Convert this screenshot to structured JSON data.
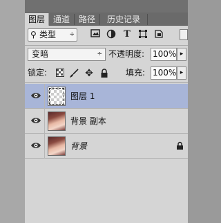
{
  "tabs": [
    {
      "label": "图层",
      "active": true
    },
    {
      "label": "通道",
      "active": false
    },
    {
      "label": "路径",
      "active": false
    },
    {
      "label": "历史记录",
      "active": false
    }
  ],
  "filter": {
    "search_symbol": "⚲",
    "kind_label": "类型",
    "caret": "÷",
    "icons": [
      "image-filter-icon",
      "adjustment-filter-icon",
      "type-filter-icon",
      "shape-filter-icon",
      "smart-object-filter-icon"
    ]
  },
  "blend": {
    "mode": "变暗",
    "caret": "÷",
    "opacity_label": "不透明度:",
    "opacity_value": "100%",
    "opacity_caret": "▸"
  },
  "locks": {
    "label": "锁定:",
    "icons": [
      "lock-transparent-icon",
      "lock-pixels-icon",
      "lock-position-icon",
      "lock-all-icon"
    ],
    "fill_label": "填充:",
    "fill_value": "100%",
    "fill_caret": "▸"
  },
  "layers": [
    {
      "name": "图层 1",
      "selected": true,
      "visible": true,
      "thumbnail": "transparent",
      "locked": false
    },
    {
      "name": "背景 副本",
      "selected": false,
      "visible": true,
      "thumbnail": "photo",
      "locked": false
    },
    {
      "name": "背景",
      "selected": false,
      "visible": true,
      "thumbnail": "photo",
      "locked": true,
      "italic": true
    }
  ],
  "colors": {
    "selected_row": "#a8b5d8",
    "panel_bg": "#d5d5d5",
    "tab_bar": "#6a6a6a"
  }
}
